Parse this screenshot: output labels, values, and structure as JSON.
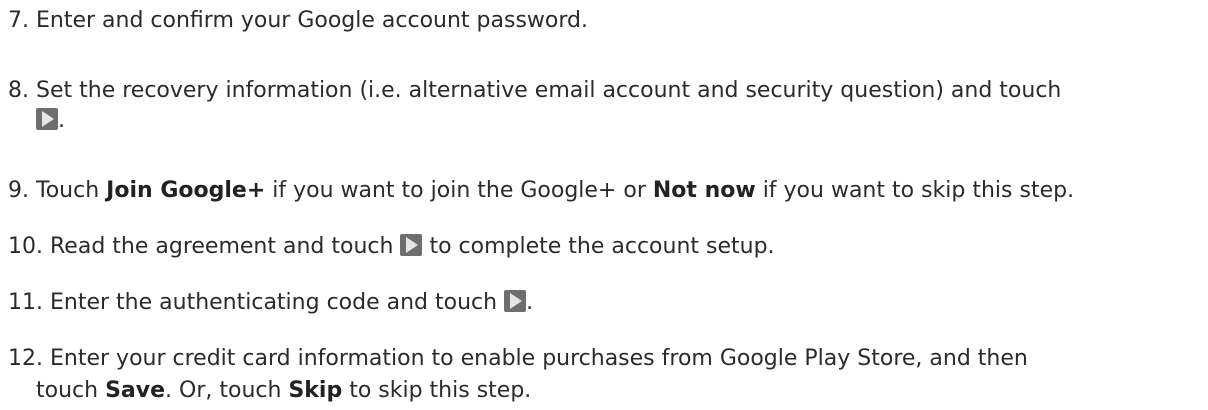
{
  "steps": [
    {
      "number": "7.",
      "text": "Enter and confirm your Google account password."
    },
    {
      "number": "8.",
      "text": "Set the recovery information (i.e. alternative email account and security question) and touch",
      "end": "."
    },
    {
      "number": "9.",
      "pre": "Touch",
      "bold1": "Join Google+",
      "mid": "if you want to join the Google+ or",
      "bold2": "Not now",
      "post": "if you want to skip this step."
    },
    {
      "number": "10.",
      "pre": "Read the agreement and touch",
      "post": "to complete the account setup."
    },
    {
      "number": "11.",
      "pre": "Enter the authenticating code and touch",
      "end": "."
    },
    {
      "number": "12.",
      "line1": "Enter your credit card information to enable purchases from Google Play Store, and then",
      "pre": "touch",
      "bold1": "Save",
      "mid": ". Or, touch",
      "bold2": "Skip",
      "post": "to skip this step."
    }
  ],
  "icons": {
    "next": "next-arrow-icon"
  },
  "colors": {
    "text": "#2b2b2b",
    "icon_bg": "#6e6e6e",
    "icon_arrow": "#e6e6e6"
  }
}
